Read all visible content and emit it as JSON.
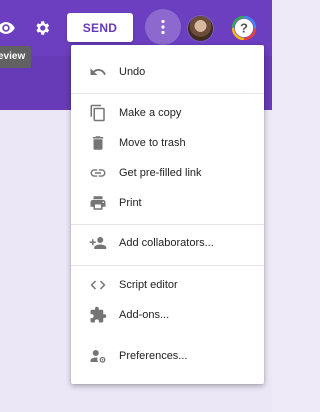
{
  "colors": {
    "accent": "#673ab7",
    "topbar": "#6b3fc0",
    "tooltip": "#616161"
  },
  "toolbar": {
    "send_label": "SEND",
    "tooltip": "eview",
    "icons": [
      "preview-icon",
      "settings-icon",
      "more-vert-icon",
      "avatar",
      "help-icon"
    ]
  },
  "menu": {
    "items": [
      {
        "label": "Undo",
        "icon": "undo-icon"
      },
      {
        "label": "Make a copy",
        "icon": "copy-icon"
      },
      {
        "label": "Move to trash",
        "icon": "trash-icon"
      },
      {
        "label": "Get pre-filled link",
        "icon": "link-icon"
      },
      {
        "label": "Print",
        "icon": "print-icon"
      },
      {
        "label": "Add collaborators...",
        "icon": "add-person-icon"
      },
      {
        "label": "Script editor",
        "icon": "code-icon"
      },
      {
        "label": "Add-ons...",
        "icon": "puzzle-icon"
      },
      {
        "label": "Preferences...",
        "icon": "person-settings-icon"
      }
    ]
  }
}
